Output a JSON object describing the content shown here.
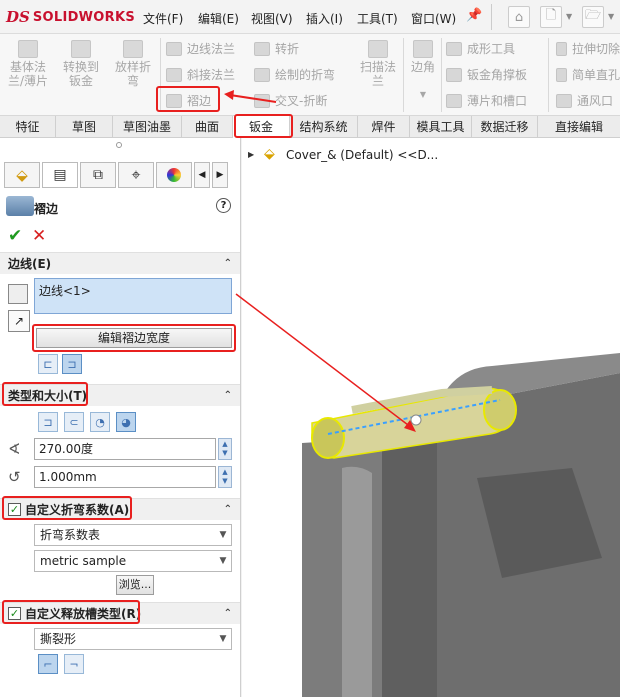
{
  "app": {
    "brand": "SOLIDWORKS",
    "ds": "DS"
  },
  "menu": [
    "文件(F)",
    "编辑(E)",
    "视图(V)",
    "插入(I)",
    "工具(T)",
    "窗口(W)"
  ],
  "ribbon": {
    "large": [
      "基体法兰/薄片",
      "转换到钣金",
      "放样折弯"
    ],
    "col2": [
      "边线法兰",
      "斜接法兰",
      "褶边"
    ],
    "col3": [
      "转折",
      "绘制的折弯",
      "交叉-折断"
    ],
    "col4": [
      "扫描法兰"
    ],
    "col5": [
      "边角"
    ],
    "col6": [
      "成形工具",
      "钣金角撑板",
      "薄片和槽口"
    ],
    "col7": [
      "拉伸切除",
      "简单直孔",
      "通风口"
    ]
  },
  "tabs": [
    "特征",
    "草图",
    "草图油墨",
    "曲面",
    "钣金",
    "结构系统",
    "焊件",
    "模具工具",
    "数据迁移",
    "直接编辑"
  ],
  "active_tab": "钣金",
  "panel": {
    "feature_title": "褶边",
    "help": "?",
    "ok": "✔",
    "cancel": "✕",
    "edges": {
      "header": "边线(E)",
      "value": "边线<1>",
      "edit_button": "编辑褶边宽度"
    },
    "type_size": {
      "header": "类型和大小(T)",
      "angle": "270.00度",
      "radius": "1.000mm"
    },
    "bend_allowance": {
      "header": "自定义折弯系数(A)",
      "type": "折弯系数表",
      "table": "metric sample",
      "browse": "浏览..."
    },
    "relief": {
      "header": "自定义释放槽类型(R)",
      "type": "撕裂形"
    }
  },
  "tree": {
    "label": "Cover_& (Default) <<D..."
  },
  "colors": {
    "highlight": "#e8201f",
    "edge": "#e8e800",
    "accent": "#3d6fb0"
  }
}
